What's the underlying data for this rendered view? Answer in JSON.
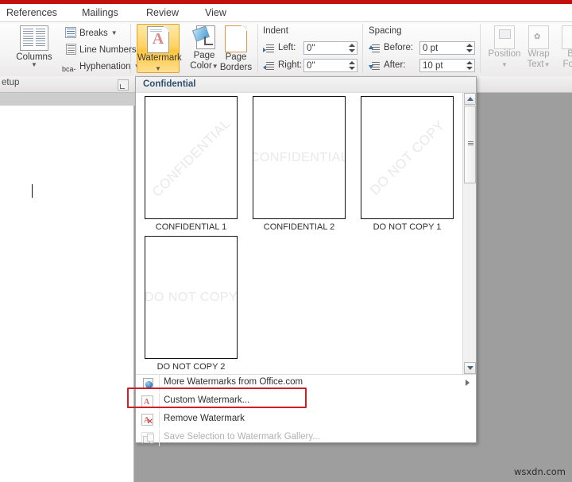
{
  "ribbon": {
    "tabs": [
      "References",
      "Mailings",
      "Review",
      "View"
    ],
    "page_setup": {
      "group_label": "etup",
      "columns_label": "Columns",
      "breaks_label": "Breaks",
      "line_numbers_label": "Line Numbers",
      "hyphenation_label": "Hyphenation",
      "hyphenation_icon_text": "bca-"
    },
    "page_background": {
      "watermark_label": "Watermark",
      "watermark_letter": "A",
      "page_color_label_1": "Page",
      "page_color_label_2": "Color",
      "page_borders_label_1": "Page",
      "page_borders_label_2": "Borders",
      "active_accent": "#ffc63d"
    },
    "paragraph": {
      "indent_title": "Indent",
      "spacing_title": "Spacing",
      "left_label": "Left:",
      "left_value": "0\"",
      "right_label": "Right:",
      "right_value": "0\"",
      "before_label": "Before:",
      "before_value": "0 pt",
      "after_label": "After:",
      "after_value": "10 pt"
    },
    "arrange": {
      "position_label": "Position",
      "wrap_text_label_1": "Wrap",
      "wrap_text_label_2": "Text",
      "bring_forward_label_1": "Br",
      "bring_forward_label_2": "Forv"
    }
  },
  "gallery": {
    "header": "Confidential",
    "items": [
      {
        "caption": "CONFIDENTIAL 1",
        "watermark": "CONFIDENTIAL",
        "style": "diagonal"
      },
      {
        "caption": "CONFIDENTIAL 2",
        "watermark": "CONFIDENTIAL",
        "style": "horizontal"
      },
      {
        "caption": "DO NOT COPY 1",
        "watermark": "DO NOT COPY",
        "style": "diagonal"
      },
      {
        "caption": "DO NOT COPY 2",
        "watermark": "DO NOT COPY",
        "style": "horizontal"
      }
    ],
    "menu": [
      {
        "label": "More Watermarks from Office.com",
        "icon": "globe-icon",
        "enabled": true,
        "submenu": true
      },
      {
        "label": "Custom Watermark...",
        "icon": "watermark-a-icon",
        "enabled": true,
        "submenu": false
      },
      {
        "label": "Remove Watermark",
        "icon": "watermark-remove-icon",
        "enabled": true,
        "submenu": false
      },
      {
        "label": "Save Selection to Watermark Gallery...",
        "icon": "save-gallery-icon",
        "enabled": false,
        "submenu": false
      }
    ],
    "highlight_color": "#cc2026",
    "highlighted_item": "Custom Watermark..."
  },
  "document": {
    "caret_visible": "true"
  },
  "overlay": {
    "site_watermark": "wsxdn.com"
  }
}
